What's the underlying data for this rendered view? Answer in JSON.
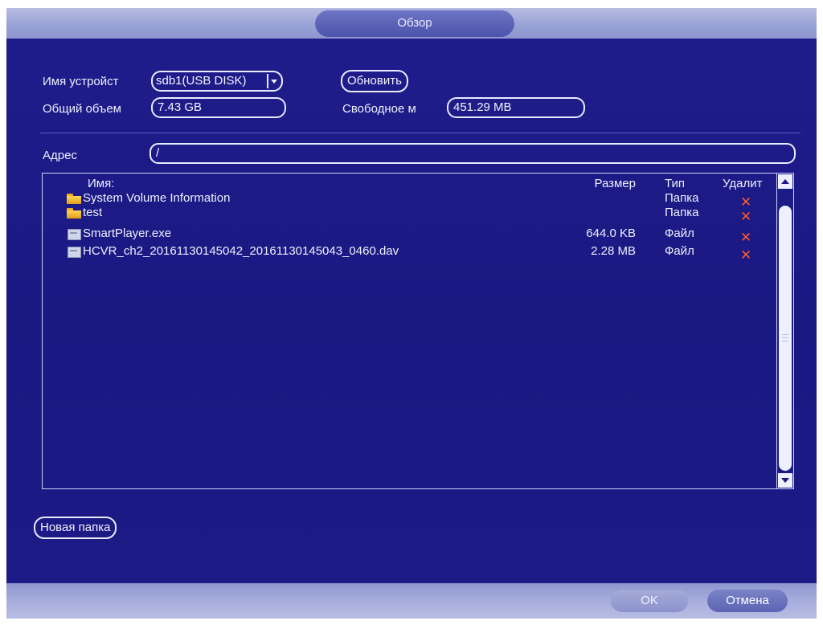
{
  "window": {
    "title": "Обзор"
  },
  "device": {
    "name_label": "Имя устройст",
    "name_value": "sdb1(USB DISK)",
    "refresh_button": "Обновить",
    "total_label": "Общий объем",
    "total_value": "7.43 GB",
    "free_label": "Свободное м",
    "free_value": "451.29 MB"
  },
  "address": {
    "label": "Адрес",
    "value": "/"
  },
  "file_list": {
    "columns": {
      "name": "Имя:",
      "size": "Размер",
      "type": "Тип",
      "delete": "Удалит"
    },
    "rows": [
      {
        "name": "System Volume Information",
        "size": "",
        "type": "Папка",
        "icon": "folder-icon",
        "delete": "✕"
      },
      {
        "name": "test",
        "size": "",
        "type": "Папка",
        "icon": "folder-icon",
        "delete": "✕"
      },
      {
        "name": "SmartPlayer.exe",
        "size": "644.0 KB",
        "type": "Файл",
        "icon": "file-icon",
        "delete": "✕"
      },
      {
        "name": "HCVR_ch2_20161130145042_20161130145043_0460.dav",
        "size": "2.28 MB",
        "type": "Файл",
        "icon": "file-icon",
        "delete": "✕"
      }
    ]
  },
  "actions": {
    "new_folder": "Новая папка",
    "ok": "OK",
    "cancel": "Отмена"
  },
  "colors": {
    "background": "#1c1a86",
    "delete_icon": "#ff5a2a",
    "folder": "#f2b022"
  }
}
